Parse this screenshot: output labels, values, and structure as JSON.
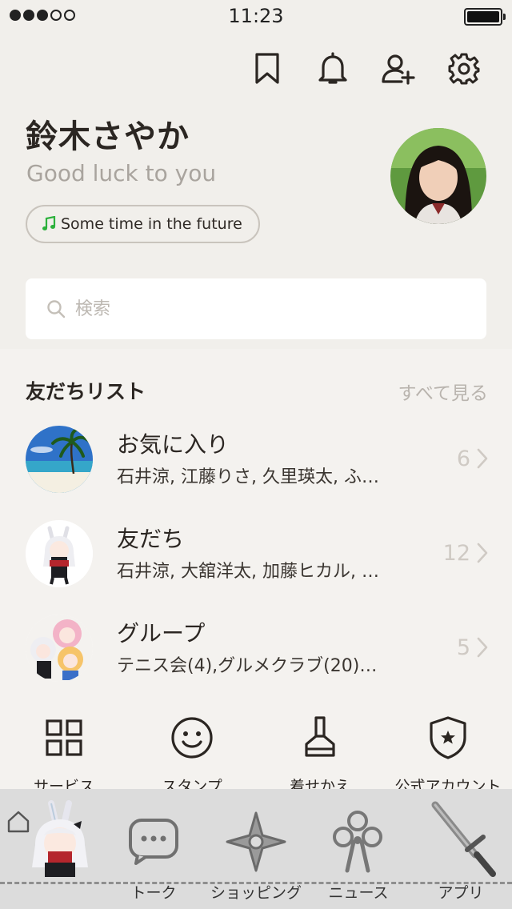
{
  "status_bar": {
    "time": "11:23"
  },
  "profile": {
    "name": "鈴木さやか",
    "status_message": "Good luck to you",
    "music": "Some time in the future"
  },
  "search": {
    "placeholder": "検索"
  },
  "friends_section": {
    "title": "友だちリスト",
    "see_all": "すべて見る",
    "rows": [
      {
        "title": "お気に入り",
        "members": "石井涼, 江藤りさ, 久里瑛太, ふ…",
        "count": "6"
      },
      {
        "title": "友だち",
        "members": "石井涼, 大舘洋太, 加藤ヒカル, …",
        "count": "12"
      },
      {
        "title": "グループ",
        "members": "テニス会(4),グルメクラブ(20)…",
        "count": "5"
      }
    ]
  },
  "services": [
    {
      "label": "サービス"
    },
    {
      "label": "スタンプ"
    },
    {
      "label": "着せかえ"
    },
    {
      "label": "公式アカウント"
    }
  ],
  "tabbar": {
    "tabs": [
      {
        "label": ""
      },
      {
        "label": "トーク"
      },
      {
        "label": "ショッピング"
      },
      {
        "label": "ニュース"
      },
      {
        "label": "アプリ"
      }
    ]
  },
  "colors": {
    "background": "#f1efeb",
    "tabbar_background": "#dcdcdc",
    "music_note": "#2cb13c",
    "muted_text": "#a9a49e"
  }
}
